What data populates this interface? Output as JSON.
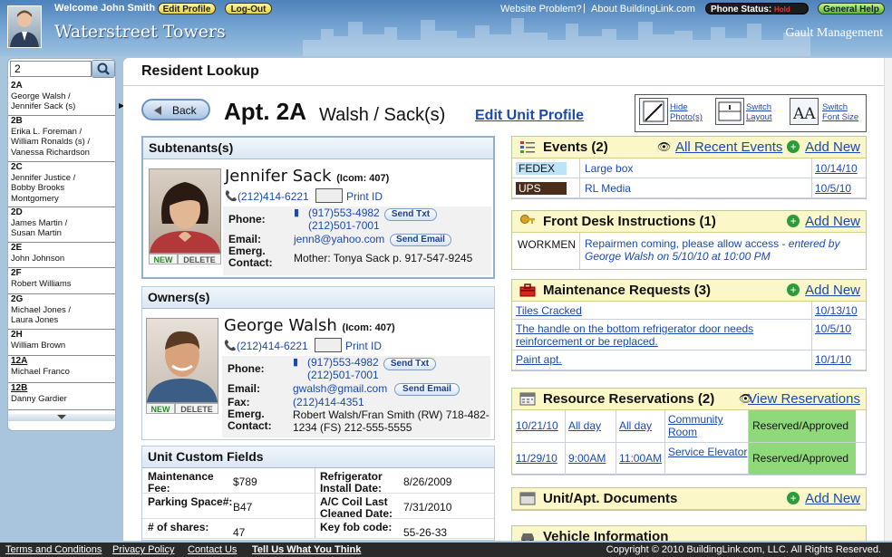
{
  "header": {
    "welcome": "Welcome John Smith",
    "edit_profile": "Edit Profile",
    "logout": "Log-Out",
    "website_problem": "Website Problem?",
    "about": "About BuildingLink.com",
    "phone_status_label": "Phone Status:",
    "phone_status_value": "Hold",
    "general_help": "General Help",
    "building_name": "Waterstreet Towers",
    "management": "Gault Management"
  },
  "search": {
    "value": "2"
  },
  "residents": [
    {
      "unit": "2A",
      "names": "George Walsh /\nJennifer Sack (s)"
    },
    {
      "unit": "2B",
      "names": "Erika L. Foreman /\nWilliam Ronalds (s) /\nVanessa Richardson"
    },
    {
      "unit": "2C",
      "names": "Jennifer Justice /\nBobby Brooks\nMontgomery"
    },
    {
      "unit": "2D",
      "names": "James Martin /\nSusan Martin"
    },
    {
      "unit": "2E",
      "names": "John Johnson"
    },
    {
      "unit": "2F",
      "names": "Robert Williams"
    },
    {
      "unit": "2G",
      "names": "Michael Jones /\nLaura Jones"
    },
    {
      "unit": "2H",
      "names": "William Brown"
    },
    {
      "unit": "12A",
      "names": "Michael Franco"
    },
    {
      "unit": "12B",
      "names": "Danny Gardier"
    }
  ],
  "page": {
    "title": "Resident Lookup",
    "back": "Back",
    "apt": "Apt. 2A",
    "apt_names": "Walsh / Sack(s)",
    "edit_unit_profile": "Edit Unit Profile"
  },
  "tools": {
    "hide_photos": "Hide\nPhoto(s)",
    "switch_layout": "Switch\nLayout",
    "switch_font": "Switch\nFont Size"
  },
  "labels": {
    "phone": "Phone:",
    "email": "Email:",
    "fax": "Fax:",
    "emerg": "Emerg.\nContact:",
    "print_id": "Print ID",
    "send_txt": "Send Txt",
    "send_email": "Send Email",
    "new": "NEW",
    "delete": "DELETE"
  },
  "subtenants": {
    "heading": "Subtenants(s)",
    "name": "Jennifer Sack",
    "icom": "(Icom: 407)",
    "home_phone": "(212)414-6221",
    "mobile": "(917)553-4982",
    "phone2": "(212)501-7001",
    "email": "jenn8@yahoo.com",
    "emergency": "Mother: Tonya Sack p. 917-547-9245"
  },
  "owners": {
    "heading": "Owners(s)",
    "name": "George Walsh",
    "icom": "(Icom: 407)",
    "home_phone": "(212)414-6221",
    "mobile": "(917)553-4982",
    "phone2": "(212)501-7001",
    "email": "gwalsh@gmail.com",
    "fax": "(212)414-4351",
    "emergency": "Robert Walsh/Fran Smith (RW) 718-482-\n1234 (FS) 212-555-5555"
  },
  "custom_fields": {
    "heading": "Unit Custom Fields",
    "rows": [
      {
        "l1": "Maintenance\nFee:",
        "v1": "$789",
        "l2": "Refrigerator\nInstall Date:",
        "v2": "8/26/2009"
      },
      {
        "l1": "Parking Space#:",
        "v1": "B47",
        "l2": "A/C Coil Last\nCleaned Date:",
        "v2": "7/31/2010"
      },
      {
        "l1": "# of shares:",
        "v1": "47",
        "l2": "Key fob code:",
        "v2": "55-26-33"
      }
    ]
  },
  "events": {
    "heading": "Events (2)",
    "all_recent": "All Recent Events",
    "add_new": "Add New",
    "rows": [
      {
        "carrier": "FEDEX",
        "desc": "Large box",
        "date": "10/14/10",
        "color": "#bfe3f6",
        "text_color": "#111"
      },
      {
        "carrier": "UPS",
        "desc": "RL Media",
        "date": "10/5/10",
        "color": "#4a2e1a",
        "text_color": "#fff"
      }
    ]
  },
  "front_desk": {
    "heading": "Front Desk Instructions (1)",
    "add_new": "Add New",
    "tag": "WORKMEN",
    "text": "Repairmen coming, please allow access - ",
    "entered_by": "entered by\nGeorge Walsh on 5/10/10 at 10:00 PM"
  },
  "maintenance": {
    "heading": "Maintenance Requests (3)",
    "add_new": "Add New",
    "rows": [
      {
        "desc": "Tiles Cracked",
        "date": "10/13/10"
      },
      {
        "desc": "The handle on the bottom refrigerator door needs\nreinforcement or be replaced.",
        "date": "10/5/10"
      },
      {
        "desc": "Paint apt.",
        "date": "10/1/10"
      }
    ]
  },
  "reservations": {
    "heading": "Resource Reservations (2)",
    "view": "View Reservations",
    "rows": [
      {
        "date": "10/21/10",
        "start": "All day",
        "end": "All day",
        "resource": "Community\nRoom",
        "status": "Reserved/Approved"
      },
      {
        "date": "11/29/10",
        "start": "9:00AM",
        "end": "11:00AM",
        "resource": "Service Elevator",
        "status": "Reserved/Approved"
      }
    ]
  },
  "documents": {
    "heading": "Unit/Apt. Documents",
    "add_new": "Add New"
  },
  "vehicle": {
    "heading": "Vehicle Information"
  },
  "footer": {
    "terms": "Terms and Conditions",
    "privacy": "Privacy Policy",
    "contact": "Contact Us",
    "tell": "Tell Us What You Think",
    "copyright": "Copyright © 2010 BuildingLink.com, LLC. All Rights Reserved."
  },
  "colors": {
    "approved": "#8fd97a",
    "link": "#1a49b0",
    "panel_yellow": "#fbf7c8"
  }
}
